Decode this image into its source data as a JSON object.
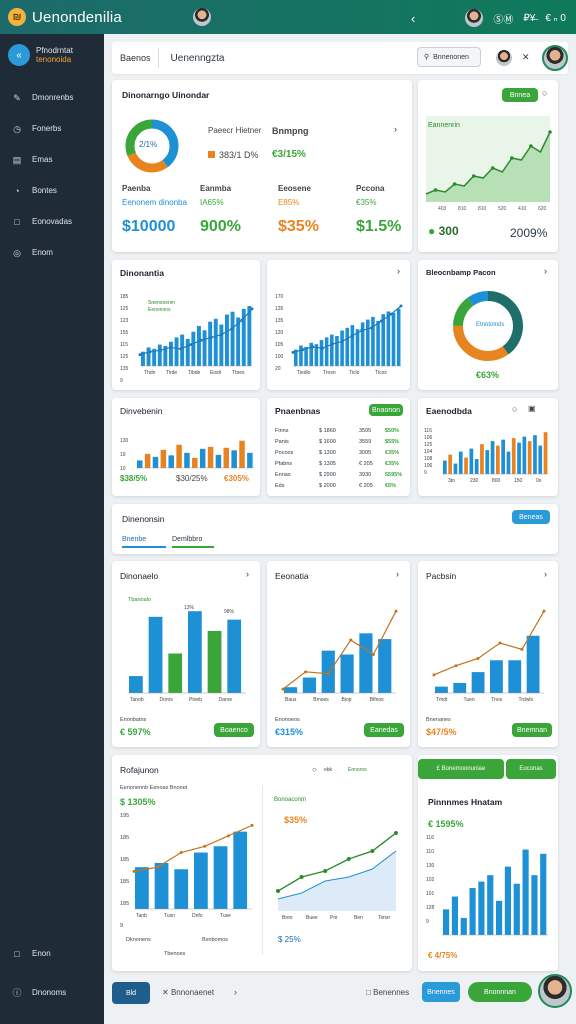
{
  "app": {
    "title": "Uenondenilia",
    "top_right": [
      "‹",
      "ⓈⓂ",
      "₽¥̶",
      "€ ₙ 0"
    ]
  },
  "sidebar": {
    "brand_line1": "Pfnodrntat",
    "brand_line2": "tenonoida",
    "items": [
      {
        "label": "Dmonrenbs",
        "icon": "pencil-icon"
      },
      {
        "label": "Fonerbs",
        "icon": "clock-icon"
      },
      {
        "label": "Emas",
        "icon": "calendar-icon"
      },
      {
        "label": "Bontes",
        "icon": "chart-icon"
      },
      {
        "label": "Eonovadas",
        "icon": "document-icon"
      },
      {
        "label": "Enom",
        "icon": "settings-icon"
      }
    ],
    "bottom": [
      {
        "label": "Enon",
        "icon": "help-icon"
      },
      {
        "label": "Dnonoms",
        "icon": "info-icon"
      }
    ]
  },
  "search": {
    "label": "Baenos",
    "value": "Uenenngzta",
    "button": "Bnnenonen"
  },
  "summary": {
    "title": "Dinonarngo Uinondar",
    "donut_label": "2/1%",
    "legend1": "Paeecr Hietner",
    "legend1_val": "383/1 D%",
    "legend2": "Bnmpng",
    "legend2_val": "€3/15%",
    "kpis": [
      {
        "label": "Paenba",
        "sub": "Eenonem dinonba",
        "value": "$10000",
        "color": "#1e90d6"
      },
      {
        "label": "Eanmba",
        "sub": "IA65%",
        "value": "900%",
        "color": "#3aa63a"
      },
      {
        "label": "Eeosene",
        "sub": "E85%",
        "value": "$35%",
        "color": "#e8841f"
      },
      {
        "label": "Pccona",
        "sub": "€35%",
        "value": "$1.5%",
        "color": "#3aa63a"
      }
    ]
  },
  "trend_card": {
    "button": "Bnnea",
    "label": "Eannenrin",
    "value": "300",
    "pct": "2009%",
    "xticks": [
      "403",
      "810",
      "810",
      "520",
      "410",
      "620"
    ]
  },
  "row2": [
    {
      "title": "Dinonantia",
      "legend": [
        "Snenonenm",
        "Eenonons"
      ],
      "yticks": [
        "185",
        "125",
        "123",
        "155",
        "115",
        "125",
        "135",
        "9"
      ],
      "bars": [
        10,
        13,
        12,
        15,
        14,
        17,
        20,
        22,
        19,
        24,
        28,
        25,
        31,
        33,
        29,
        36,
        38,
        34,
        40,
        42
      ],
      "line": [
        8,
        10,
        11,
        13,
        12,
        15,
        18,
        20,
        22,
        26,
        32,
        40
      ],
      "xticks": [
        "Thdn",
        "Tirde",
        "Tibde",
        "Eisdr",
        "Ttoes"
      ]
    },
    {
      "title": "",
      "yticks": [
        "170",
        "135",
        "135",
        "120",
        "105",
        "100",
        "20"
      ],
      "bars": [
        12,
        15,
        14,
        17,
        16,
        19,
        21,
        23,
        22,
        26,
        28,
        30,
        27,
        32,
        34,
        36,
        33,
        38,
        40,
        39,
        42
      ],
      "line": [
        10,
        12,
        14,
        13,
        16,
        18,
        22,
        26,
        28,
        33,
        38,
        44
      ],
      "xticks": [
        "Tiedlo",
        "Trosn",
        "Ticlo",
        "Ticos"
      ]
    },
    {
      "title": "Bleocnbamp Pacon",
      "center": "Etnotolnds",
      "value": "€63%",
      "slices": [
        40,
        35,
        15,
        10
      ]
    }
  ],
  "row3": [
    {
      "title": "Dinvebenin",
      "vals": [
        15,
        28,
        22,
        36,
        25,
        46,
        30,
        20,
        38,
        42,
        26,
        40,
        35,
        54,
        30
      ],
      "val1": "$38/5%",
      "val2": "$30/25%",
      "val3": "€305%",
      "yticks": [
        "130",
        "19",
        "10"
      ]
    },
    {
      "title": "Pnaenbnas",
      "button": "Bnaonon",
      "rows": [
        [
          "Finns",
          "$ 1860",
          "3505",
          "$50%"
        ],
        [
          "Panis",
          "$ 1600",
          "3559",
          "$55%"
        ],
        [
          "Pocoos",
          "$ 1300",
          "3005",
          "€35%"
        ],
        [
          "Pfabns",
          "$ 1305",
          "€ 205",
          "€35%"
        ],
        [
          "Ennas",
          "$ 2900",
          "3930",
          "5595%"
        ],
        [
          "Eds",
          "$ 2000",
          "€ 205",
          "€6%"
        ]
      ]
    },
    {
      "title": "Eaenodbda",
      "vals": [
        18,
        26,
        14,
        30,
        22,
        34,
        20,
        40,
        32,
        44,
        38,
        46,
        30,
        48,
        42,
        50,
        44,
        52,
        38,
        56
      ],
      "yticks": [
        "116",
        "106",
        "125",
        "104",
        "108",
        "106",
        "9"
      ],
      "xticks": [
        "3to",
        "230",
        "800",
        "150",
        "0o"
      ]
    }
  ],
  "section": {
    "title": "Dinenonsin",
    "button": "Beneas",
    "tabs": [
      "Bnenbe",
      "Demlbbro"
    ]
  },
  "row4": [
    {
      "title": "Dinonaelo",
      "legend": "Tbanoalo",
      "vals": [
        12,
        54,
        28,
        58,
        44,
        52
      ],
      "colors": [
        "#1e90d6",
        "#1e90d6",
        "#3aa63a",
        "#1e90d6",
        "#3aa63a",
        "#1e90d6"
      ],
      "labels": [
        "13%",
        "98%"
      ],
      "xticks": [
        "Tanob",
        "Donrs",
        "Ptonb",
        "Danre"
      ],
      "foot": "Enonbatns",
      "value": "€ 597%",
      "button": "Boaenco"
    },
    {
      "title": "Eeonatia",
      "vals": [
        6,
        16,
        44,
        40,
        62,
        56
      ],
      "line": [
        4,
        22,
        20,
        55,
        40,
        85
      ],
      "xticks": [
        "Baus",
        "Bmoes",
        "Biop",
        "Blfnos"
      ],
      "foot": "Enonoeos",
      "value": "€315%",
      "button": "Eanedas"
    },
    {
      "title": "Pacbsin",
      "vals": [
        7,
        11,
        23,
        36,
        36,
        63
      ],
      "line": [
        20,
        30,
        38,
        55,
        48,
        90
      ],
      "xticks": [
        "Tmdr",
        "Tuen",
        "Tnos",
        "Trdwls"
      ],
      "foot": "Bnenanes",
      "value": "$47/5%",
      "button": "Bnemnan"
    }
  ],
  "row5": [
    {
      "title": "Rofajunon",
      "ctrl": [
        "ebk",
        "Ennoros"
      ],
      "sub": "Eenonennb Eenoas Bnonet",
      "value": "$ 1305%",
      "vals": [
        20,
        22,
        19,
        27,
        30,
        37
      ],
      "line": [
        18,
        20,
        27,
        30,
        35,
        40
      ],
      "yticks": [
        "195",
        "185",
        "185",
        "185",
        "185",
        "9"
      ],
      "legend": [
        "Dknonens",
        "Tbenoes",
        "Bxnbomos"
      ],
      "xticks": [
        "Tanb",
        "Tusn",
        "Dnfo",
        "Tuse"
      ]
    },
    {
      "title": "Bonoaconm",
      "value": "$35%",
      "legend": "$ 25%",
      "line1": [
        20,
        34,
        40,
        52,
        60,
        78
      ],
      "line2": [
        12,
        18,
        30,
        34,
        42,
        60
      ],
      "xticks": [
        "Breo",
        "Buee",
        "Pnr",
        "Ben",
        "Tonsr"
      ]
    },
    {
      "title": "Pinnnmes Hnatam",
      "button": "£ Bonemoonuniae",
      "button2": "Eoconas",
      "value": "€ 1595%",
      "vals": [
        12,
        18,
        8,
        22,
        25,
        28,
        16,
        32,
        24,
        40,
        28,
        38
      ],
      "yticks": [
        "116",
        "110",
        "130",
        "102",
        "101",
        "128",
        "9"
      ],
      "legend": "€ 4/75%"
    }
  ],
  "bottombar": {
    "btn": "Bld",
    "label": "Bnnonaenet",
    "right_label": "Benennes",
    "right_btn1": "Bnennes",
    "right_btn2": "Bnonnnan"
  }
}
